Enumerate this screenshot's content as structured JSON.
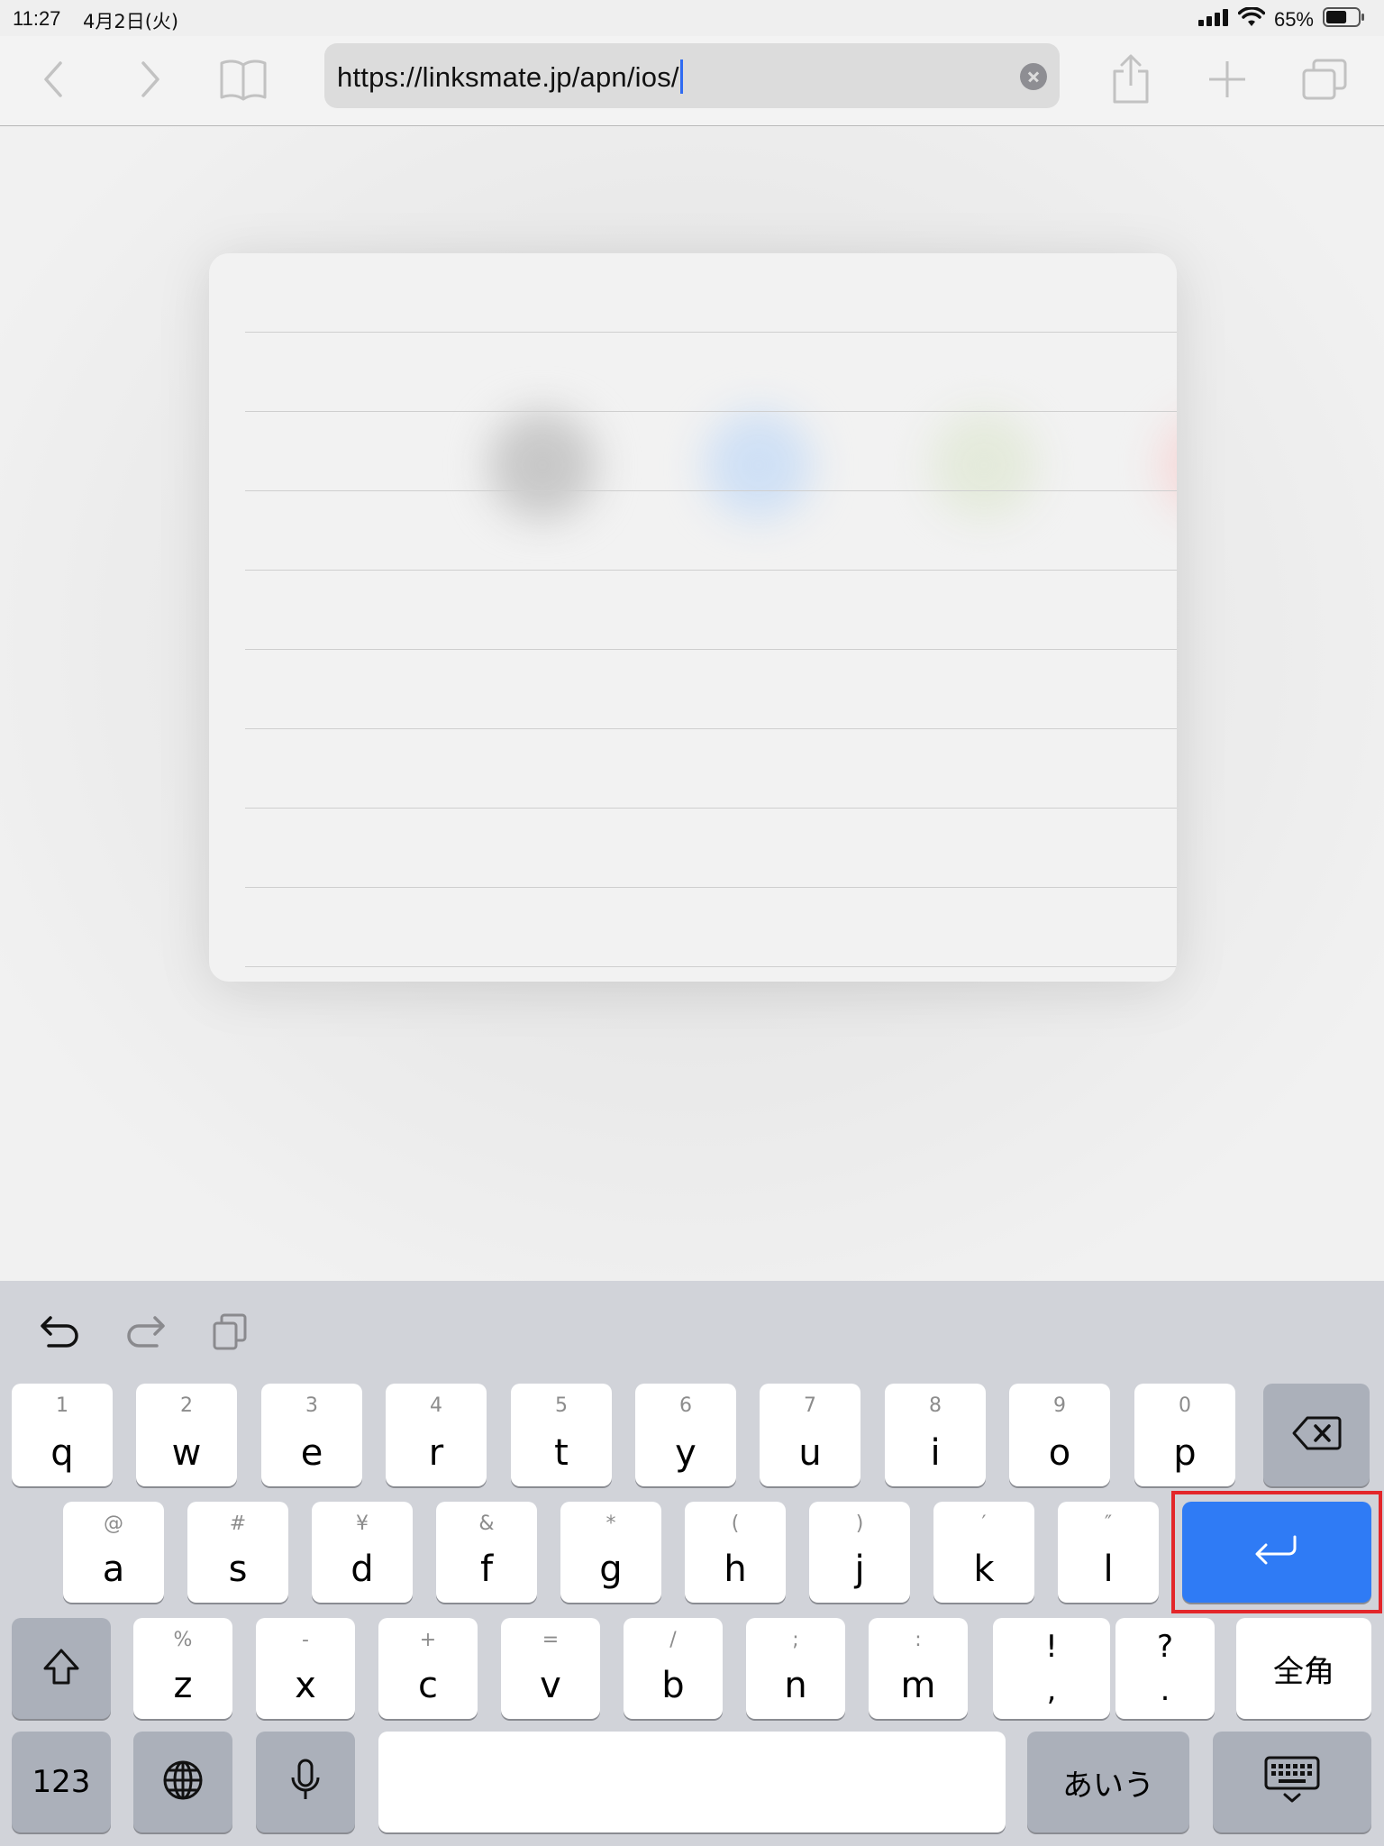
{
  "status_bar": {
    "time": "11:27",
    "date": "4月2日(火)",
    "battery_percent": "65%",
    "battery_level": 0.65
  },
  "toolbar": {
    "url": "https://linksmate.jp/apn/ios/",
    "back_icon": "chevron-left-icon",
    "forward_icon": "chevron-right-icon",
    "bookmarks_icon": "book-icon",
    "share_icon": "share-icon",
    "new_tab_icon": "plus-icon",
    "tabs_icon": "tabs-icon"
  },
  "keyboard": {
    "tools": [
      "undo-icon",
      "redo-icon",
      "paste-icon"
    ],
    "row1": [
      {
        "letter": "q",
        "alt": "1"
      },
      {
        "letter": "w",
        "alt": "2"
      },
      {
        "letter": "e",
        "alt": "3"
      },
      {
        "letter": "r",
        "alt": "4"
      },
      {
        "letter": "t",
        "alt": "5"
      },
      {
        "letter": "y",
        "alt": "6"
      },
      {
        "letter": "u",
        "alt": "7"
      },
      {
        "letter": "i",
        "alt": "8"
      },
      {
        "letter": "o",
        "alt": "9"
      },
      {
        "letter": "p",
        "alt": "0"
      }
    ],
    "row2": [
      {
        "letter": "a",
        "alt": "@"
      },
      {
        "letter": "s",
        "alt": "#"
      },
      {
        "letter": "d",
        "alt": "¥"
      },
      {
        "letter": "f",
        "alt": "&"
      },
      {
        "letter": "g",
        "alt": "*"
      },
      {
        "letter": "h",
        "alt": "("
      },
      {
        "letter": "j",
        "alt": ")"
      },
      {
        "letter": "k",
        "alt": "′"
      },
      {
        "letter": "l",
        "alt": "″"
      }
    ],
    "row3": [
      {
        "letter": "z",
        "alt": "%"
      },
      {
        "letter": "x",
        "alt": "-"
      },
      {
        "letter": "c",
        "alt": "+"
      },
      {
        "letter": "v",
        "alt": "="
      },
      {
        "letter": "b",
        "alt": "/"
      },
      {
        "letter": "n",
        "alt": ";"
      },
      {
        "letter": "m",
        "alt": ":"
      }
    ],
    "punct1": {
      "top": "!",
      "bottom": ","
    },
    "punct2": {
      "top": "?",
      "bottom": "."
    },
    "fullwidth_label": "全角",
    "numbers_label": "123",
    "kana_label": "あいう",
    "globe_icon": "globe-icon",
    "mic_icon": "microphone-icon",
    "shift_icon": "shift-icon",
    "delete_icon": "delete-icon",
    "return_icon": "return-icon",
    "dismiss_icon": "keyboard-dismiss-icon",
    "accent_color": "#2f7bf5",
    "highlight_color": "#e3262a"
  }
}
